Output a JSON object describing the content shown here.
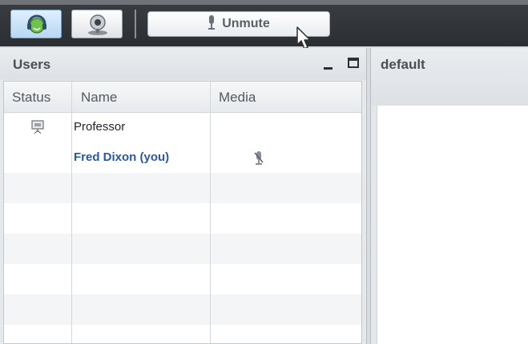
{
  "toolbar": {
    "phone_icon": "headset-phone-icon",
    "webcam_icon": "webcam-icon",
    "unmute_label": "Unmute",
    "unmute_icon": "microphone-icon"
  },
  "users_panel": {
    "title": "Users",
    "columns": [
      "Status",
      "Name",
      "Media"
    ],
    "rows": [
      {
        "status_icon": "presenter-icon",
        "name": "Professor",
        "media_icon": ""
      },
      {
        "status_icon": "",
        "name": "Fred Dixon (you)",
        "media_icon": "microphone-muted-icon"
      }
    ]
  },
  "right_panel": {
    "title": "default"
  },
  "colors": {
    "toolbar_bg": "#2b2e33",
    "you_name": "#2b57a6",
    "phone_button": "#b8d7f2"
  }
}
